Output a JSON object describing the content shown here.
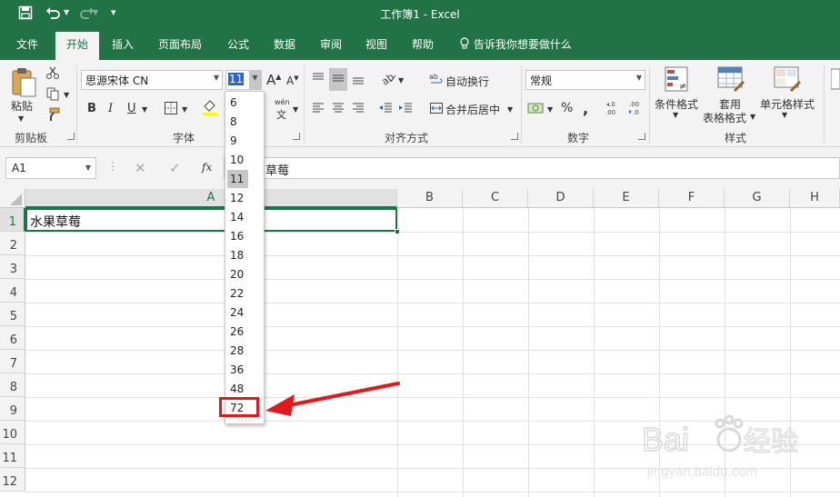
{
  "window": {
    "title": "工作簿1  -  Excel"
  },
  "quick_access": {
    "more": "▾"
  },
  "tabs": [
    {
      "label": "文件"
    },
    {
      "label": "开始"
    },
    {
      "label": "插入"
    },
    {
      "label": "页面布局"
    },
    {
      "label": "公式"
    },
    {
      "label": "数据"
    },
    {
      "label": "审阅"
    },
    {
      "label": "视图"
    },
    {
      "label": "帮助"
    }
  ],
  "tell_me": {
    "label": "告诉我你想要做什么"
  },
  "ribbon": {
    "clipboard": {
      "label": "剪贴板",
      "paste": "粘贴"
    },
    "font": {
      "label": "字体",
      "font_name": "思源宋体 CN",
      "font_size": "11",
      "bold": "B",
      "italic": "I",
      "underline": "U",
      "wen": "wén",
      "wen_char": "文"
    },
    "alignment": {
      "label": "对齐方式",
      "wrap_text": "自动换行",
      "merge_center": "合并后居中"
    },
    "number": {
      "label": "数字",
      "format": "常规",
      "percent": "%"
    },
    "styles": {
      "label": "样式",
      "conditional": "条件格式",
      "table_format_1": "套用",
      "table_format_2": "表格格式",
      "cell_styles": "单元格样式"
    }
  },
  "formula_bar": {
    "name_box": "A1",
    "content": "草莓",
    "fx": "fx"
  },
  "grid": {
    "columns": [
      "A",
      "B",
      "C",
      "D",
      "E",
      "F",
      "G",
      "H"
    ],
    "rows": [
      "1",
      "2",
      "3",
      "4",
      "5",
      "6",
      "7",
      "8",
      "9",
      "10",
      "11",
      "12"
    ],
    "cell_a1": "水果草莓"
  },
  "font_size_dropdown": {
    "options": [
      "6",
      "8",
      "9",
      "10",
      "11",
      "12",
      "14",
      "16",
      "18",
      "20",
      "22",
      "24",
      "26",
      "28",
      "36",
      "48",
      "72"
    ],
    "selected": "11",
    "grip": "·····"
  },
  "annotation": {
    "color": "#e0191c"
  },
  "colors": {
    "excel_green": "#217346",
    "ribbon_bg": "#f3f3f3",
    "highlight_red": "#e0191c"
  }
}
